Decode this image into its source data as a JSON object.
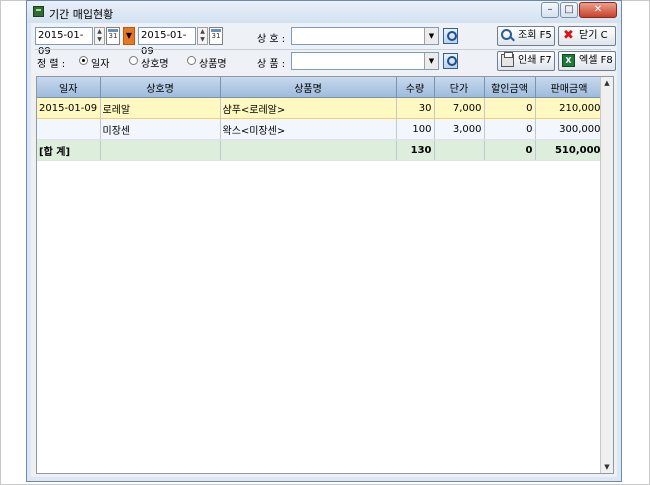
{
  "window": {
    "title": "기간 매입현황",
    "minimize_icon": "minimize-icon",
    "maximize_icon": "maximize-icon",
    "close_icon": "close-icon"
  },
  "filters": {
    "start_date": "2015-01-09",
    "end_date": "2015-01-09",
    "calendar_glyph": "31",
    "store_label": "상 호 :",
    "store_value": "",
    "product_label": "상 품 :",
    "product_value": "",
    "sort_label": "정 렬 :",
    "sort_options": [
      {
        "label": "일자",
        "checked": true
      },
      {
        "label": "상호명",
        "checked": false
      },
      {
        "label": "상품명",
        "checked": false
      }
    ]
  },
  "actions": {
    "search_label": "조회 F5",
    "close_label": "닫기 C",
    "print_label": "인쇄 F7",
    "excel_label": "엑셀 F8"
  },
  "table": {
    "columns": [
      "일자",
      "상호명",
      "상품명",
      "수량",
      "단가",
      "할인금액",
      "판매금액"
    ],
    "rows": [
      {
        "date": "2015-01-09",
        "store": "로레알",
        "product": "샴푸<로레알>",
        "qty": "30",
        "price": "7,000",
        "discount": "0",
        "amount": "210,000"
      },
      {
        "date": "",
        "store": "미장센",
        "product": "왁스<미장센>",
        "qty": "100",
        "price": "3,000",
        "discount": "0",
        "amount": "300,000"
      }
    ],
    "total": {
      "label": "[합 계]",
      "qty": "130",
      "discount": "0",
      "amount": "510,000"
    }
  },
  "colors": {
    "accent": "#e87722",
    "header_bg": "#9fbbdb",
    "selected_row": "#fff8c0",
    "total_row": "#ddeedd"
  }
}
